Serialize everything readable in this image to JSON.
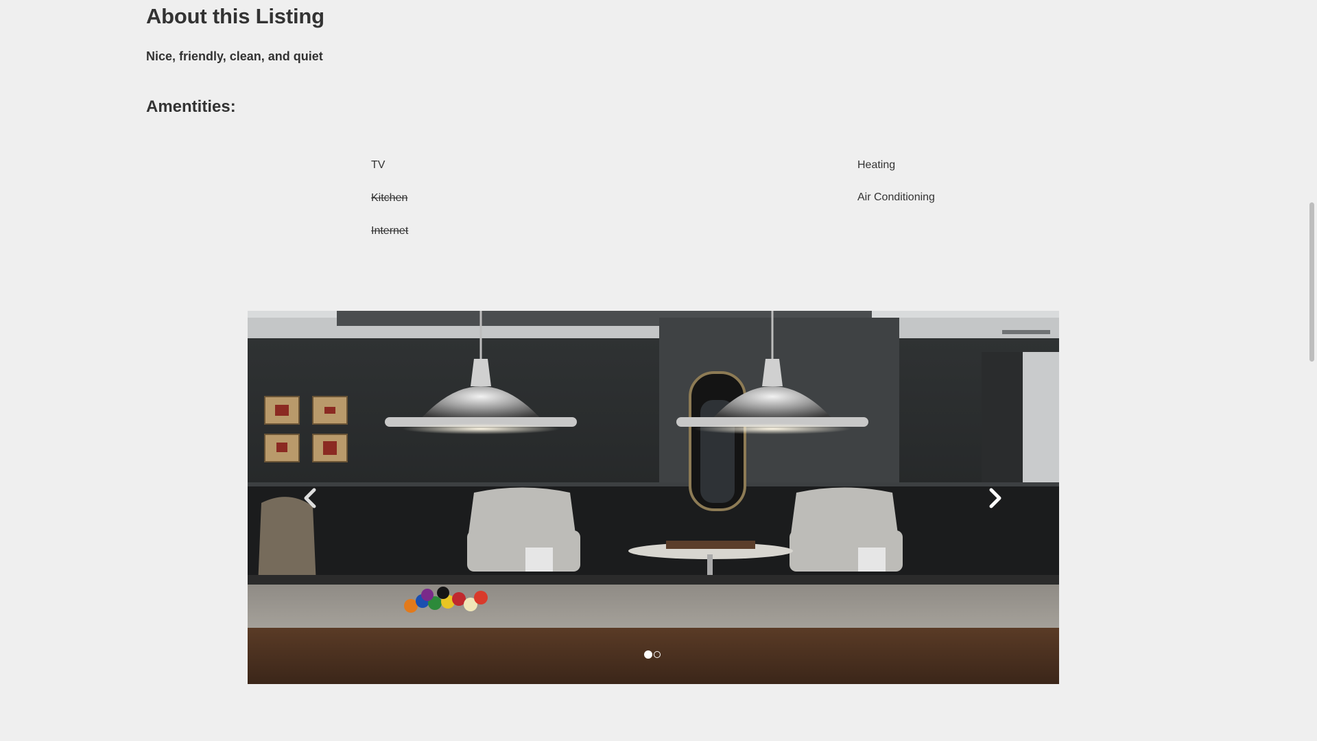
{
  "listing": {
    "title": "About this Listing",
    "description": "Nice, friendly, clean, and quiet"
  },
  "amenities": {
    "heading": "Amentities:",
    "left": [
      {
        "label": "TV",
        "available": true
      },
      {
        "label": "Kitchen",
        "available": false
      },
      {
        "label": "Internet",
        "available": false
      }
    ],
    "right": [
      {
        "label": "Heating",
        "available": true
      },
      {
        "label": "Air Conditioning",
        "available": true
      }
    ]
  },
  "carousel": {
    "image_subject": "game room with billiard table, two pendant lamps, two wingback chairs and a chess table",
    "slide_count": 2,
    "active_slide": 1,
    "prev_icon": "chevron-left-icon",
    "next_icon": "chevron-right-icon"
  },
  "colors": {
    "background": "#efefef",
    "text": "#333333",
    "scrollbar_thumb": "#bdbdbd"
  }
}
